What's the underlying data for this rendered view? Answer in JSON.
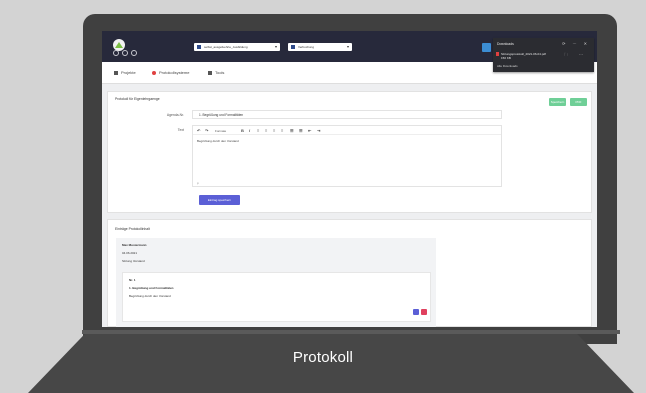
{
  "caption": "Protokoll",
  "app": {
    "select_primary": "selbst_ausgefuehrte_Ausbildung",
    "select_secondary": "Verbuchung"
  },
  "download_panel": {
    "title": "Downloads",
    "file_name": "Sitzungsprotokoll_2021-06-04.pdf",
    "file_meta": "150 KB",
    "footer": "Alle Downloads"
  },
  "tabs": [
    {
      "label": "Projekte",
      "color": "#555555"
    },
    {
      "label": "Protokollsysteme",
      "color": "#e04040"
    },
    {
      "label": "Tools",
      "color": "#555555"
    }
  ],
  "protocol_card": {
    "title": "Protokoll für Eigenlehrgaenge",
    "save_label": "Speichern",
    "pdf_label": "PDF",
    "number_label": "Agenda-Nr.",
    "number_value": "1. Begrüßung und Formalitäten",
    "text_label": "Text",
    "format_label": "Formate",
    "body_text": "Begrüßung durch den Vorstand",
    "status": "p",
    "submit_label": "Eintrag speichern"
  },
  "entries_card": {
    "title": "Einträge Protokollinhalt",
    "author": "Max Mustermann",
    "date_line": "04.06.2021",
    "subject_line": "Sitzung Vorstand",
    "entry_label": "Nr. 1",
    "entry_heading": "1. Begrüßung und Formalitäten",
    "entry_text": "Begrüßung durch den Vorstand",
    "edit_color": "#5b5fd6",
    "delete_color": "#e0405e"
  },
  "colors": {
    "topbar": "#27293b",
    "accent_blue": "#3c8dd4",
    "accent_green": "#6fcf97",
    "accent_purple": "#5b5fd6"
  }
}
